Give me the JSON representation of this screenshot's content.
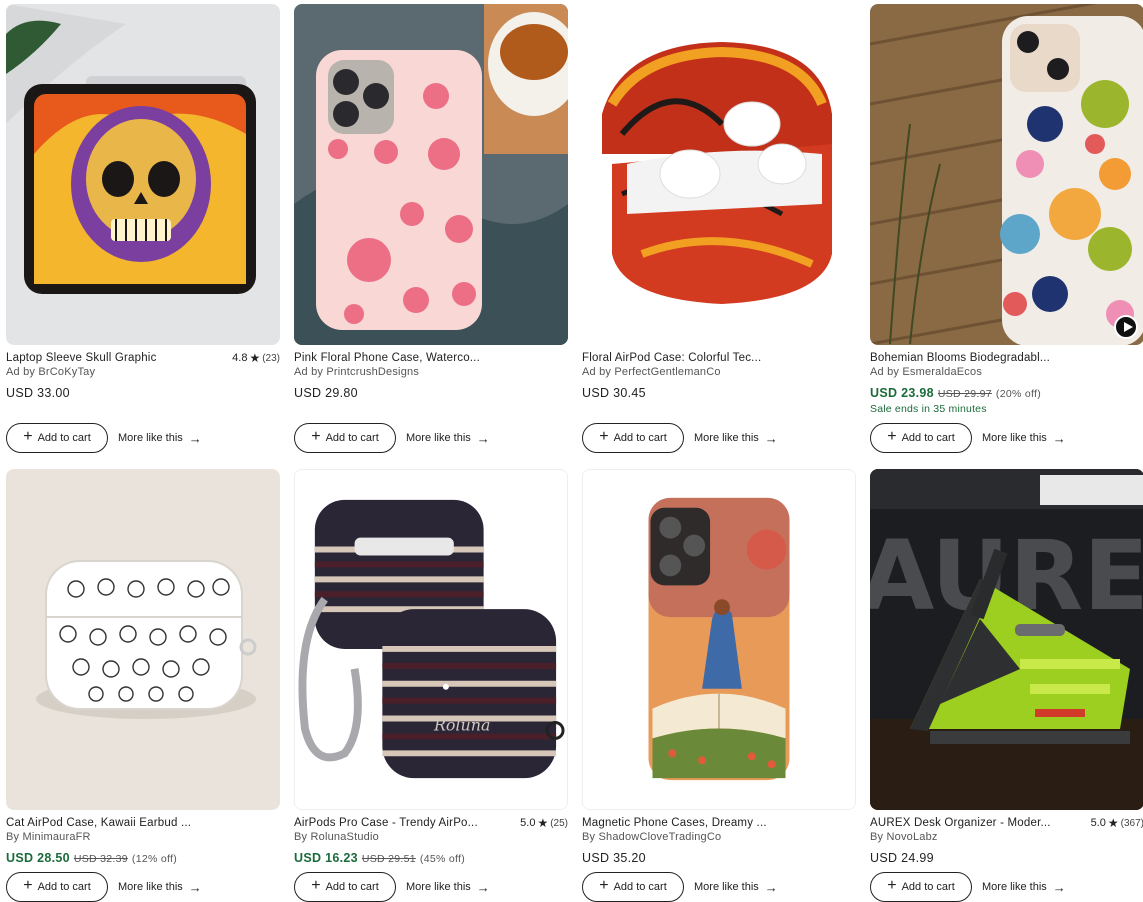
{
  "cart_label": "Add to cart",
  "more_label": "More like this",
  "listings": [
    {
      "title": "Laptop Sleeve Skull Graphic",
      "rating": "4.8",
      "reviews": "(23)",
      "seller": "Ad by BrCoKyTay",
      "price": "USD 33.00",
      "orig": "",
      "off": "",
      "sale_ends": ""
    },
    {
      "title": "Pink Floral Phone Case, Waterco...",
      "rating": "",
      "reviews": "",
      "seller": "Ad by PrintcrushDesigns",
      "price": "USD 29.80",
      "orig": "",
      "off": "",
      "sale_ends": ""
    },
    {
      "title": "Floral AirPod Case: Colorful Tec...",
      "rating": "",
      "reviews": "",
      "seller": "Ad by PerfectGentlemanCo",
      "price": "USD 30.45",
      "orig": "",
      "off": "",
      "sale_ends": ""
    },
    {
      "title": "Bohemian Blooms Biodegradabl...",
      "rating": "",
      "reviews": "",
      "seller": "Ad by EsmeraldaEcos",
      "price": "USD 23.98",
      "orig": "USD 29.97",
      "off": "(20% off)",
      "sale_ends": "Sale ends in 35 minutes"
    },
    {
      "title": "Cat AirPod Case, Kawaii Earbud ...",
      "rating": "",
      "reviews": "",
      "seller": "By MinimauraFR",
      "price": "USD 28.50",
      "orig": "USD 32.39",
      "off": "(12% off)",
      "sale_ends": ""
    },
    {
      "title": "AirPods Pro Case - Trendy AirPo...",
      "rating": "5.0",
      "reviews": "(25)",
      "seller": "By RolunaStudio",
      "price": "USD 16.23",
      "orig": "USD 29.51",
      "off": "(45% off)",
      "sale_ends": ""
    },
    {
      "title": "Magnetic Phone Cases, Dreamy ...",
      "rating": "",
      "reviews": "",
      "seller": "By ShadowCloveTradingCo",
      "price": "USD 35.20",
      "orig": "",
      "off": "",
      "sale_ends": ""
    },
    {
      "title": "AUREX Desk Organizer - Moder...",
      "rating": "5.0",
      "reviews": "(367)",
      "seller": "By NovoLabz",
      "price": "USD 24.99",
      "orig": "",
      "off": "",
      "sale_ends": ""
    }
  ],
  "images": {
    "case_name": "Roluna",
    "logo_text": "AUREX"
  },
  "colors": {
    "sale_green": "#1b6b3a"
  }
}
